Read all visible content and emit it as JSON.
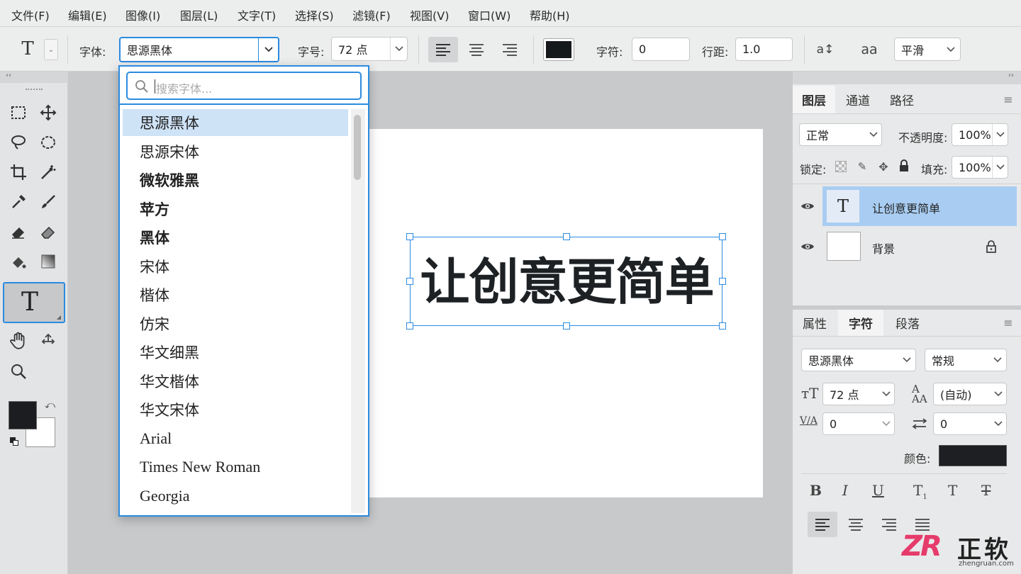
{
  "menu": [
    "文件(F)",
    "编辑(E)",
    "图像(I)",
    "图层(L)",
    "文字(T)",
    "选择(S)",
    "滤镜(F)",
    "视图(V)",
    "窗口(W)",
    "帮助(H)"
  ],
  "options": {
    "font_label": "字体:",
    "font_value": "思源黑体",
    "size_label": "字号:",
    "size_value": "72 点",
    "tracking_label": "字符:",
    "tracking_value": "0",
    "leading_label": "行距:",
    "leading_value": "1.0",
    "antialias_value": "平滑",
    "text_color": "#16191c"
  },
  "font_dropdown": {
    "search_placeholder": "搜索字体...",
    "fonts": [
      "思源黑体",
      "思源宋体",
      "微软雅黑",
      "苹方",
      "黑体",
      "宋体",
      "楷体",
      "仿宋",
      "华文细黑",
      "华文楷体",
      "华文宋体",
      "Arial",
      "Times New Roman",
      "Georgia"
    ],
    "selected_index": 0
  },
  "canvas": {
    "text": "让创意更简单"
  },
  "layers_panel": {
    "tabs": [
      "图层",
      "通道",
      "路径"
    ],
    "blend_mode": "正常",
    "opacity_label": "不透明度:",
    "opacity_value": "100%",
    "lock_label": "锁定:",
    "fill_label": "填充:",
    "fill_value": "100%",
    "layers": [
      {
        "name": "让创意更简单",
        "type": "text",
        "selected": true
      },
      {
        "name": "背景",
        "type": "background",
        "locked": true
      }
    ]
  },
  "char_panel": {
    "tabs": [
      "属性",
      "字符",
      "段落"
    ],
    "font_family": "思源黑体",
    "font_style": "常规",
    "size_value": "72 点",
    "leading_value": "(自动)",
    "kerning_value": "0",
    "tracking_value": "0",
    "color_label": "颜色:",
    "color_value": "#1d1f22"
  },
  "watermark": {
    "logo_text": "ZR",
    "cn_text": "正软",
    "url": "zhengruan.com"
  }
}
